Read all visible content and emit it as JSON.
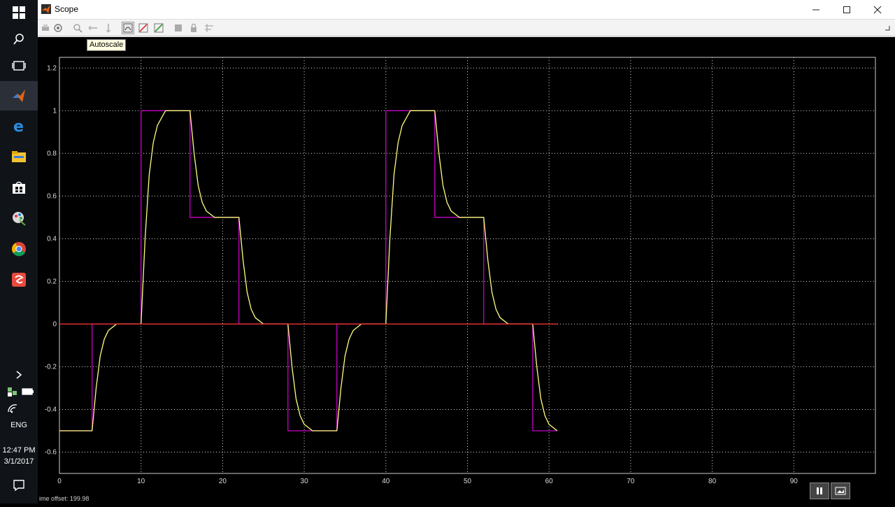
{
  "window": {
    "title": "Scope"
  },
  "toolbar": {
    "tooltip": "Autoscale"
  },
  "taskbar": {
    "lang": "ENG",
    "time": "12:47 PM",
    "date": "3/1/2017"
  },
  "status": {
    "time_offset": "ime offset:  199.98"
  },
  "colors": {
    "axis_bg": "#000000",
    "grid": "#d9d9d9",
    "series_input": "#c800c8",
    "series_output": "#ffff80",
    "zero_line": "#ff3333"
  },
  "chart_data": {
    "type": "line",
    "title": "",
    "xlabel": "",
    "ylabel": "",
    "xlim": [
      0,
      100
    ],
    "ylim": [
      -0.7,
      1.25
    ],
    "xticks": [
      0,
      10,
      20,
      30,
      40,
      50,
      60,
      70,
      80,
      90
    ],
    "yticks": [
      1.2,
      1,
      0.8,
      0.6,
      0.4,
      0.2,
      0,
      -0.2,
      -0.4,
      -0.6
    ],
    "ytick_labels": [
      "1.2",
      "1",
      "0.8",
      "0.6",
      "0.4",
      "0.2",
      "0",
      "-0.2",
      "-0.4",
      "-0.6"
    ],
    "grid": true,
    "series": [
      {
        "color": "#c800c8",
        "x": [
          0,
          4,
          4,
          10,
          10,
          16,
          16,
          22,
          22,
          28,
          28,
          34,
          34,
          40,
          40,
          46,
          46,
          52,
          52,
          58,
          58,
          61
        ],
        "y": [
          -0.5,
          -0.5,
          0,
          0,
          1,
          1,
          0.5,
          0.5,
          0,
          0,
          -0.5,
          -0.5,
          0,
          0,
          1,
          1,
          0.5,
          0.5,
          0,
          0,
          -0.5,
          -0.5
        ]
      },
      {
        "color": "#ffff80",
        "x": [
          0,
          4,
          4.5,
          5,
          5.5,
          6,
          7,
          10,
          10.5,
          11,
          11.5,
          12,
          13,
          16,
          16.5,
          17,
          17.5,
          18,
          19,
          22,
          22.5,
          23,
          23.5,
          24,
          25,
          28,
          28.5,
          29,
          29.5,
          30,
          31,
          34,
          34.5,
          35,
          35.5,
          36,
          37,
          40,
          40.5,
          41,
          41.5,
          42,
          43,
          46,
          46.5,
          47,
          47.5,
          48,
          49,
          52,
          52.5,
          53,
          53.5,
          54,
          55,
          58,
          58.5,
          59,
          59.5,
          60,
          61
        ],
        "y": [
          -0.5,
          -0.5,
          -0.3,
          -0.15,
          -0.07,
          -0.03,
          0,
          0,
          0.4,
          0.7,
          0.85,
          0.93,
          1,
          1,
          0.8,
          0.65,
          0.57,
          0.53,
          0.5,
          0.5,
          0.3,
          0.15,
          0.07,
          0.03,
          0,
          0,
          -0.2,
          -0.35,
          -0.43,
          -0.47,
          -0.5,
          -0.5,
          -0.3,
          -0.15,
          -0.07,
          -0.03,
          0,
          0,
          0.4,
          0.7,
          0.85,
          0.93,
          1,
          1,
          0.8,
          0.65,
          0.57,
          0.53,
          0.5,
          0.5,
          0.3,
          0.15,
          0.07,
          0.03,
          0,
          0,
          -0.2,
          -0.35,
          -0.43,
          -0.47,
          -0.5
        ]
      },
      {
        "color": "#ff3333",
        "x": [
          0,
          61
        ],
        "y": [
          0,
          0
        ]
      }
    ]
  }
}
